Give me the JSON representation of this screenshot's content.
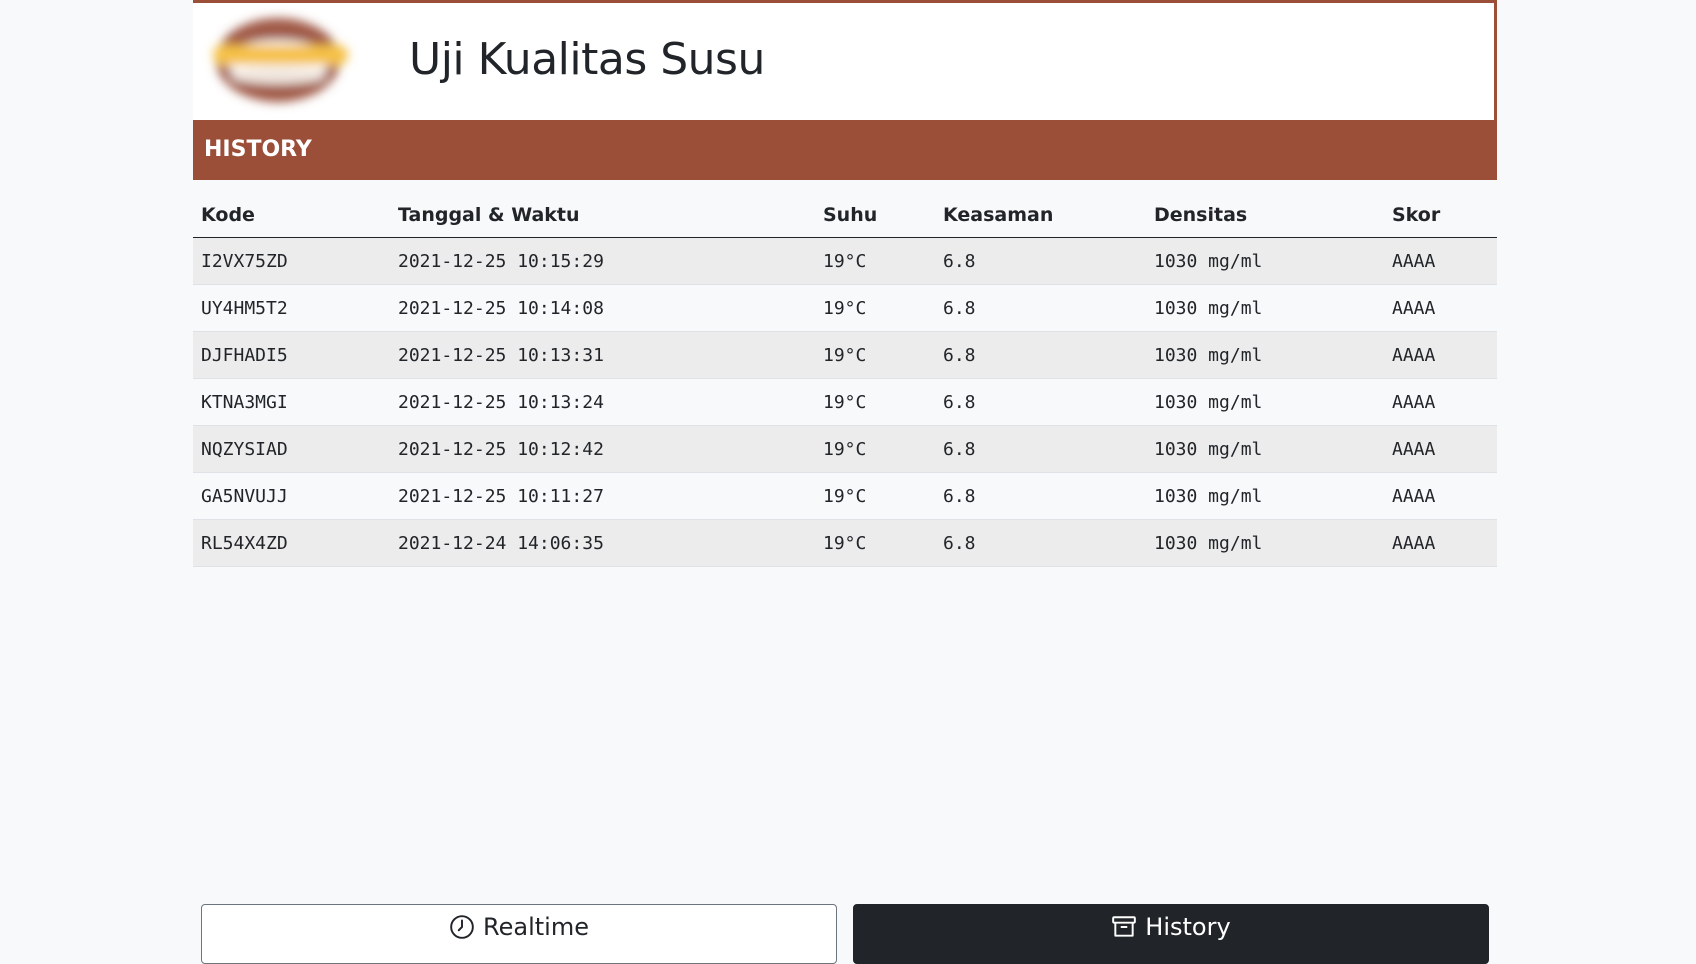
{
  "app": {
    "title": "Uji Kualitas Susu"
  },
  "section": {
    "title": "HISTORY"
  },
  "table": {
    "headers": {
      "kode": "Kode",
      "tanggal": "Tanggal & Waktu",
      "suhu": "Suhu",
      "keasaman": "Keasaman",
      "densitas": "Densitas",
      "skor": "Skor"
    },
    "rows": [
      {
        "kode": "I2VX75ZD",
        "tanggal": "2021-12-25 10:15:29",
        "suhu": "19°C",
        "keasaman": "6.8",
        "densitas": "1030 mg/ml",
        "skor": "AAAA"
      },
      {
        "kode": "UY4HM5T2",
        "tanggal": "2021-12-25 10:14:08",
        "suhu": "19°C",
        "keasaman": "6.8",
        "densitas": "1030 mg/ml",
        "skor": "AAAA"
      },
      {
        "kode": "DJFHADI5",
        "tanggal": "2021-12-25 10:13:31",
        "suhu": "19°C",
        "keasaman": "6.8",
        "densitas": "1030 mg/ml",
        "skor": "AAAA"
      },
      {
        "kode": "KTNA3MGI",
        "tanggal": "2021-12-25 10:13:24",
        "suhu": "19°C",
        "keasaman": "6.8",
        "densitas": "1030 mg/ml",
        "skor": "AAAA"
      },
      {
        "kode": "NQZYSIAD",
        "tanggal": "2021-12-25 10:12:42",
        "suhu": "19°C",
        "keasaman": "6.8",
        "densitas": "1030 mg/ml",
        "skor": "AAAA"
      },
      {
        "kode": "GA5NVUJJ",
        "tanggal": "2021-12-25 10:11:27",
        "suhu": "19°C",
        "keasaman": "6.8",
        "densitas": "1030 mg/ml",
        "skor": "AAAA"
      },
      {
        "kode": "RL54X4ZD",
        "tanggal": "2021-12-24 14:06:35",
        "suhu": "19°C",
        "keasaman": "6.8",
        "densitas": "1030 mg/ml",
        "skor": "AAAA"
      }
    ]
  },
  "nav": {
    "realtime": {
      "label": "Realtime",
      "icon": "clock-icon"
    },
    "history": {
      "label": "History",
      "icon": "archive-icon"
    }
  },
  "colors": {
    "brand": "#9b4f38",
    "active_button": "#212529"
  }
}
